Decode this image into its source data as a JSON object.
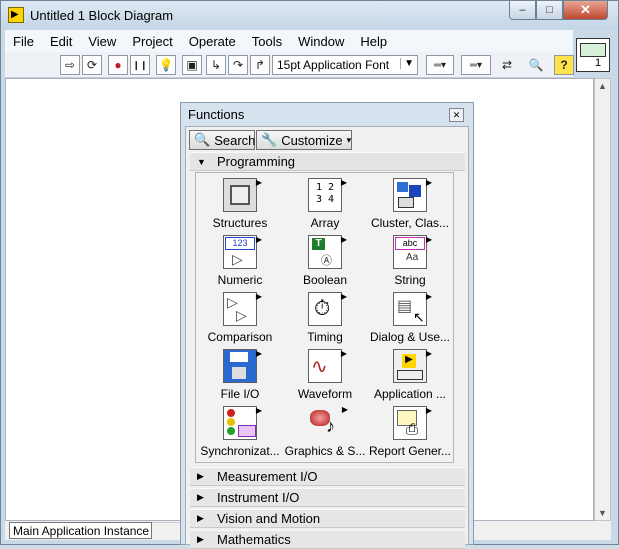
{
  "window": {
    "title": "Untitled 1 Block Diagram",
    "app_icon_letter": "▶"
  },
  "window_controls": {
    "minimize": "–",
    "maximize": "□",
    "close": "✕"
  },
  "menu": [
    "File",
    "Edit",
    "View",
    "Project",
    "Operate",
    "Tools",
    "Window",
    "Help"
  ],
  "toolbar": {
    "run": "⇨",
    "run_continuous": "⟳",
    "abort": "●",
    "pause": "❙❙",
    "highlight": "💡",
    "retain": "▣",
    "step_into": "↳",
    "step_over": "↷",
    "step_out": "↱",
    "font": "15pt Application Font",
    "font_arrow": "▼",
    "align": "═▾",
    "distribute": "═▾",
    "reorder": "⇄",
    "search": "🔍",
    "help": "?",
    "vi_icon_number": "1"
  },
  "status": {
    "context": "Main Application Instance"
  },
  "palette": {
    "title": "Functions",
    "close": "✕",
    "search_label": "Search",
    "customize_label": "Customize",
    "customize_arrow": "▾",
    "categories": [
      {
        "label": "Programming",
        "expanded": "▼"
      },
      {
        "label": "Measurement I/O",
        "expanded": "▶"
      },
      {
        "label": "Instrument I/O",
        "expanded": "▶"
      },
      {
        "label": "Vision and Motion",
        "expanded": "▶"
      },
      {
        "label": "Mathematics",
        "expanded": "▶"
      }
    ],
    "items": [
      {
        "label": "Structures",
        "glyph": "▣"
      },
      {
        "label": "Array",
        "glyph": "1 2 3 4"
      },
      {
        "label": "Cluster, Clas...",
        "glyph": "▩"
      },
      {
        "label": "Numeric",
        "glyph": "123"
      },
      {
        "label": "Boolean",
        "glyph": "T"
      },
      {
        "label": "String",
        "glyph": "abc"
      },
      {
        "label": "Comparison",
        "glyph": "▷"
      },
      {
        "label": "Timing",
        "glyph": "⏱"
      },
      {
        "label": "Dialog & Use...",
        "glyph": "▤"
      },
      {
        "label": "File I/O",
        "glyph": "💾"
      },
      {
        "label": "Waveform",
        "glyph": "∿"
      },
      {
        "label": "Application ...",
        "glyph": "▶"
      },
      {
        "label": "Synchronizat...",
        "glyph": "●"
      },
      {
        "label": "Graphics & S...",
        "glyph": "♪"
      },
      {
        "label": "Report Gener...",
        "glyph": "⎙"
      }
    ]
  },
  "colors": {
    "title_bar": "#c4d5e6",
    "palette_bg": "#d6e3ef",
    "close_btn": "#c0482f"
  }
}
